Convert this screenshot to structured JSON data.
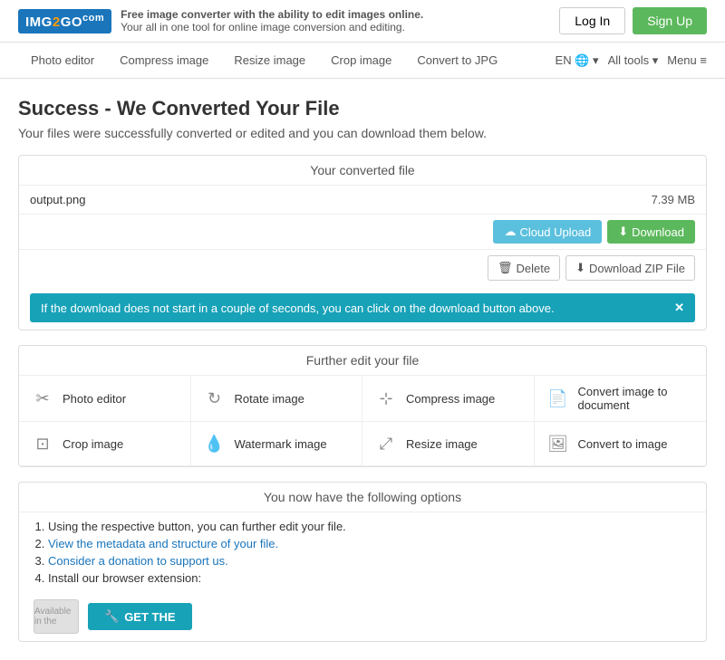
{
  "header": {
    "logo_text": "IMG2GO",
    "logo_two": "2",
    "logo_go": "GO",
    "tagline_line1": "Free image converter with the ability to edit images online.",
    "tagline_line2": "Your all in one tool for online image conversion and editing.",
    "login_label": "Log In",
    "signup_label": "Sign Up"
  },
  "nav": {
    "links": [
      {
        "label": "Photo editor"
      },
      {
        "label": "Compress image"
      },
      {
        "label": "Resize image"
      },
      {
        "label": "Crop image"
      },
      {
        "label": "Convert to JPG"
      }
    ],
    "right": {
      "language": "EN",
      "all_tools": "All tools",
      "menu": "Menu"
    }
  },
  "page": {
    "title": "Success - We Converted Your File",
    "subtitle": "Your files were successfully converted or edited and you can download them below.",
    "converted_section": {
      "title": "Your converted file",
      "file_name": "output.png",
      "file_size": "7.39 MB",
      "cloud_upload_label": "Cloud Upload",
      "download_label": "Download",
      "delete_label": "Delete",
      "zip_label": "Download ZIP File",
      "info_banner": "If the download does not start in a couple of seconds, you can click on the download button above.",
      "info_close": "✕"
    },
    "edit_section": {
      "title": "Further edit your file",
      "items": [
        {
          "icon": "✂",
          "label": "Photo editor"
        },
        {
          "icon": "↻",
          "label": "Rotate image"
        },
        {
          "icon": "⊹",
          "label": "Compress image"
        },
        {
          "icon": "📄",
          "label": "Convert image to document"
        },
        {
          "icon": "⊡",
          "label": "Crop image"
        },
        {
          "icon": "💧",
          "label": "Watermark image"
        },
        {
          "icon": "⤢",
          "label": "Resize image"
        },
        {
          "icon": "🖼",
          "label": "Convert to image"
        }
      ]
    },
    "options_section": {
      "title": "You now have the following options",
      "items": [
        {
          "text": "Using the respective button, you can further edit your file.",
          "link": null
        },
        {
          "text": "View the metadata and structure of your file.",
          "link": "View the metadata and structure of your file."
        },
        {
          "text": "Consider a donation to support us.",
          "link": "Consider a donation to support us."
        },
        {
          "text": "Install our browser extension:",
          "link": null
        }
      ]
    },
    "extension": {
      "available_in": "Available in the",
      "get_label": "GET THE"
    }
  }
}
